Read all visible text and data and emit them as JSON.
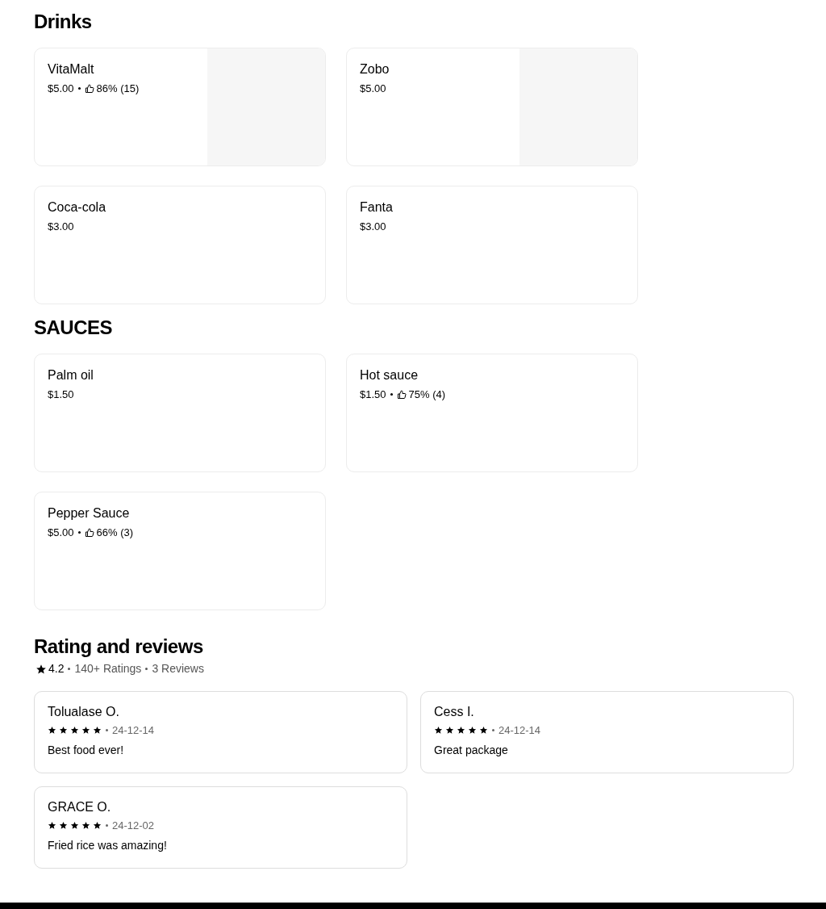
{
  "sections": [
    {
      "title": "Drinks",
      "items": [
        {
          "name": "VitaMalt",
          "price": "$5.00",
          "rating": "86% (15)",
          "image": true
        },
        {
          "name": "Zobo",
          "price": "$5.00",
          "image": true
        },
        {
          "name": "Coca-cola",
          "price": "$3.00"
        },
        {
          "name": "Fanta",
          "price": "$3.00"
        }
      ]
    },
    {
      "title": "SAUCES",
      "items": [
        {
          "name": "Palm oil",
          "price": "$1.50"
        },
        {
          "name": "Hot sauce",
          "price": "$1.50",
          "rating": "75% (4)"
        },
        {
          "name": "Pepper Sauce",
          "price": "$5.00",
          "rating": "66% (3)"
        }
      ]
    }
  ],
  "reviews_section": {
    "title": "Rating and reviews",
    "score": "4.2",
    "ratings": "140+ Ratings",
    "count": "3 Reviews",
    "reviews": [
      {
        "name": "Tolualase O.",
        "stars": 5,
        "date": "24-12-14",
        "text": "Best food ever!"
      },
      {
        "name": "Cess I.",
        "stars": 5,
        "date": "24-12-14",
        "text": "Great package"
      },
      {
        "name": "GRACE O.",
        "stars": 5,
        "date": "24-12-02",
        "text": "Fried rice was amazing!"
      }
    ]
  }
}
